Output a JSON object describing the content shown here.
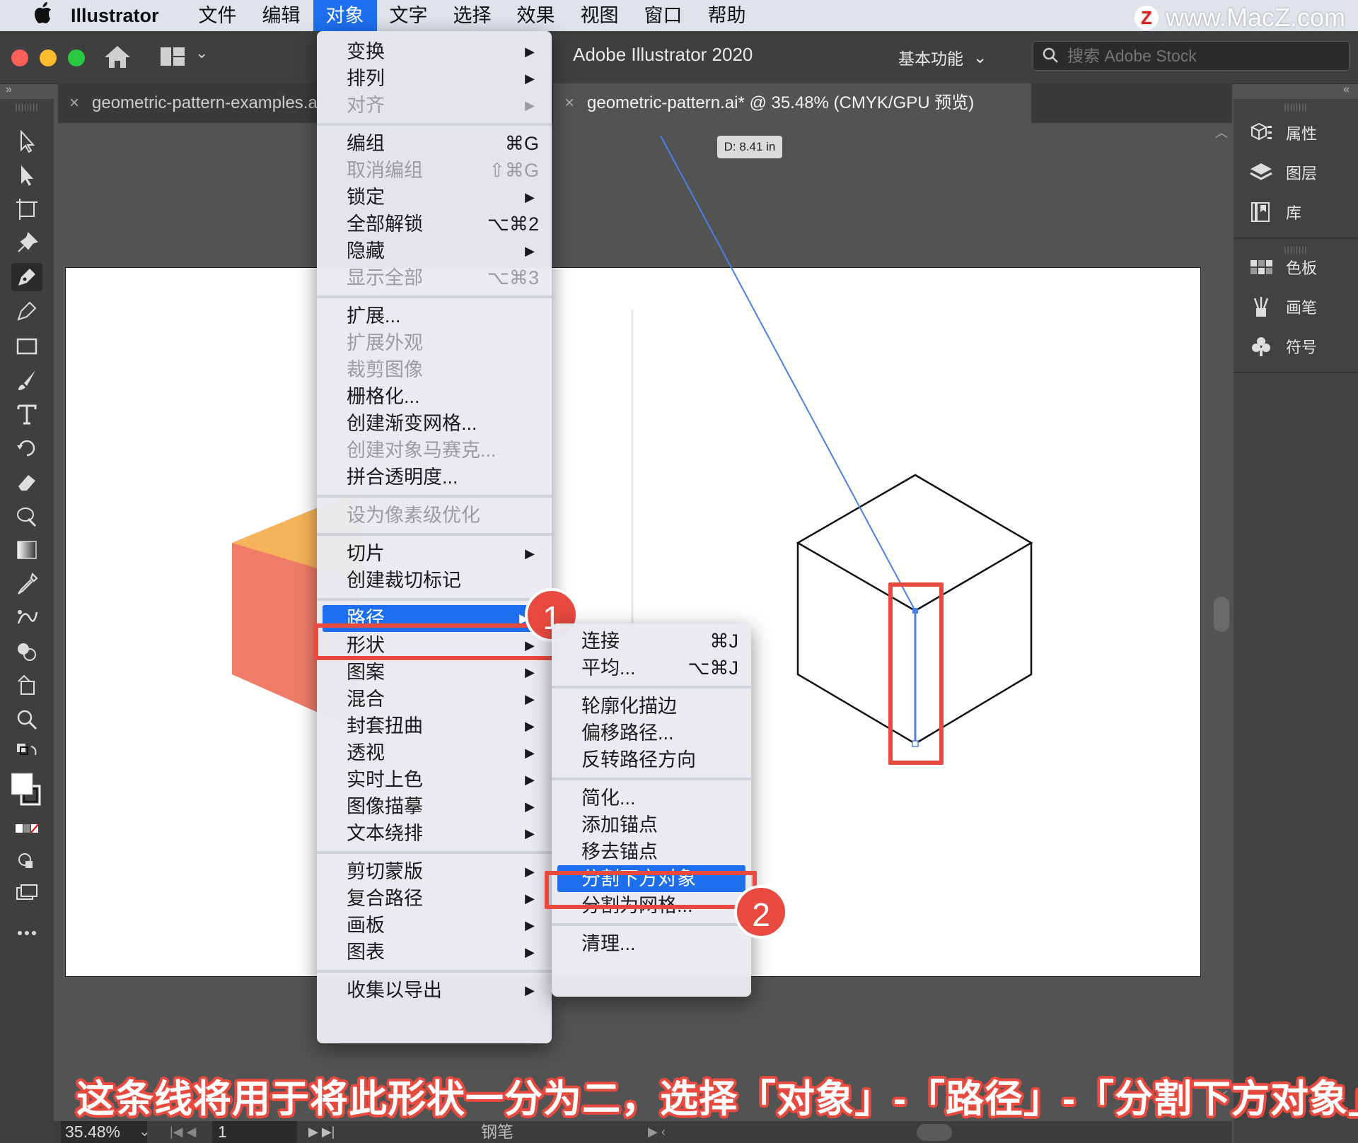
{
  "menubar": {
    "app_name": "Illustrator",
    "items": [
      {
        "label": "文件",
        "active": false
      },
      {
        "label": "编辑",
        "active": false
      },
      {
        "label": "对象",
        "active": true
      },
      {
        "label": "文字",
        "active": false
      },
      {
        "label": "选择",
        "active": false
      },
      {
        "label": "效果",
        "active": false
      },
      {
        "label": "视图",
        "active": false
      },
      {
        "label": "窗口",
        "active": false
      },
      {
        "label": "帮助",
        "active": false
      }
    ],
    "watermark": "www.MacZ.com",
    "watermark_logo": "Z"
  },
  "titlebar": {
    "title": "Adobe Illustrator 2020",
    "workspace": "基本功能",
    "stock_search_placeholder": "搜索 Adobe Stock"
  },
  "tabs": [
    {
      "label": "geometric-pattern-examples.ai",
      "close": "×"
    },
    {
      "label": "geometric-pattern.ai* @ 35.48% (CMYK/GPU 预览)",
      "close": "×"
    }
  ],
  "panel_collapse": {
    "left": "»",
    "right": "«"
  },
  "canvas": {
    "tooltip": "D: 8.41 in"
  },
  "object_menu": {
    "items": [
      {
        "label": "变换",
        "shortcut": "",
        "submenu": true,
        "disabled": false
      },
      {
        "label": "排列",
        "shortcut": "",
        "submenu": true,
        "disabled": false
      },
      {
        "label": "对齐",
        "shortcut": "",
        "submenu": true,
        "disabled": true
      },
      {
        "label": "编组",
        "shortcut": "⌘G",
        "submenu": false,
        "disabled": false
      },
      {
        "label": "取消编组",
        "shortcut": "⇧⌘G",
        "submenu": false,
        "disabled": true
      },
      {
        "label": "锁定",
        "shortcut": "",
        "submenu": true,
        "disabled": false
      },
      {
        "label": "全部解锁",
        "shortcut": "⌥⌘2",
        "submenu": false,
        "disabled": false
      },
      {
        "label": "隐藏",
        "shortcut": "",
        "submenu": true,
        "disabled": false
      },
      {
        "label": "显示全部",
        "shortcut": "⌥⌘3",
        "submenu": false,
        "disabled": true
      },
      {
        "label": "扩展...",
        "shortcut": "",
        "submenu": false,
        "disabled": false
      },
      {
        "label": "扩展外观",
        "shortcut": "",
        "submenu": false,
        "disabled": true
      },
      {
        "label": "裁剪图像",
        "shortcut": "",
        "submenu": false,
        "disabled": true
      },
      {
        "label": "栅格化...",
        "shortcut": "",
        "submenu": false,
        "disabled": false
      },
      {
        "label": "创建渐变网格...",
        "shortcut": "",
        "submenu": false,
        "disabled": false
      },
      {
        "label": "创建对象马赛克...",
        "shortcut": "",
        "submenu": false,
        "disabled": true
      },
      {
        "label": "拼合透明度...",
        "shortcut": "",
        "submenu": false,
        "disabled": false
      },
      {
        "label": "设为像素级优化",
        "shortcut": "",
        "submenu": false,
        "disabled": true
      },
      {
        "label": "切片",
        "shortcut": "",
        "submenu": true,
        "disabled": false
      },
      {
        "label": "创建裁切标记",
        "shortcut": "",
        "submenu": false,
        "disabled": false
      },
      {
        "label": "路径",
        "shortcut": "",
        "submenu": true,
        "disabled": false,
        "highlight": true
      },
      {
        "label": "形状",
        "shortcut": "",
        "submenu": true,
        "disabled": false
      },
      {
        "label": "图案",
        "shortcut": "",
        "submenu": true,
        "disabled": false
      },
      {
        "label": "混合",
        "shortcut": "",
        "submenu": true,
        "disabled": false
      },
      {
        "label": "封套扭曲",
        "shortcut": "",
        "submenu": true,
        "disabled": false
      },
      {
        "label": "透视",
        "shortcut": "",
        "submenu": true,
        "disabled": false
      },
      {
        "label": "实时上色",
        "shortcut": "",
        "submenu": true,
        "disabled": false
      },
      {
        "label": "图像描摹",
        "shortcut": "",
        "submenu": true,
        "disabled": false
      },
      {
        "label": "文本绕排",
        "shortcut": "",
        "submenu": true,
        "disabled": false
      },
      {
        "label": "剪切蒙版",
        "shortcut": "",
        "submenu": true,
        "disabled": false
      },
      {
        "label": "复合路径",
        "shortcut": "",
        "submenu": true,
        "disabled": false
      },
      {
        "label": "画板",
        "shortcut": "",
        "submenu": true,
        "disabled": false
      },
      {
        "label": "图表",
        "shortcut": "",
        "submenu": true,
        "disabled": false
      },
      {
        "label": "收集以导出",
        "shortcut": "",
        "submenu": true,
        "disabled": false
      }
    ],
    "submenu_arrow": "▶"
  },
  "path_menu": {
    "items": [
      {
        "label": "连接",
        "shortcut": "⌘J",
        "highlight": false
      },
      {
        "label": "平均...",
        "shortcut": "⌥⌘J",
        "highlight": false
      },
      {
        "label": "轮廓化描边",
        "shortcut": "",
        "highlight": false
      },
      {
        "label": "偏移路径...",
        "shortcut": "",
        "highlight": false
      },
      {
        "label": "反转路径方向",
        "shortcut": "",
        "highlight": false
      },
      {
        "label": "简化...",
        "shortcut": "",
        "highlight": false
      },
      {
        "label": "添加锚点",
        "shortcut": "",
        "highlight": false
      },
      {
        "label": "移去锚点",
        "shortcut": "",
        "highlight": false
      },
      {
        "label": "分割下方对象",
        "shortcut": "",
        "highlight": true
      },
      {
        "label": "分割为网格...",
        "shortcut": "",
        "highlight": false
      },
      {
        "label": "清理...",
        "shortcut": "",
        "highlight": false
      }
    ]
  },
  "right_panel": {
    "group1": [
      {
        "label": "属性",
        "icon": "properties-icon"
      },
      {
        "label": "图层",
        "icon": "layers-icon"
      },
      {
        "label": "库",
        "icon": "libraries-icon"
      }
    ],
    "group2": [
      {
        "label": "色板",
        "icon": "swatches-icon"
      },
      {
        "label": "画笔",
        "icon": "brushes-icon"
      },
      {
        "label": "符号",
        "icon": "symbols-icon"
      }
    ]
  },
  "statusbar": {
    "zoom": "35.48%",
    "page": "1",
    "tool": "钢笔"
  },
  "annotations": {
    "badge1": "1",
    "badge2": "2",
    "caption": "这条线将用于将此形状一分为二，选择「对象」-「路径」-「分割下方对象」",
    "accent": "#e84a3f"
  },
  "colors": {
    "menu_highlight": "#1e6ff0",
    "hex_orange": "#f7b35a",
    "hex_coral": "#ef7c68",
    "path_blue": "#4a7fe8"
  }
}
